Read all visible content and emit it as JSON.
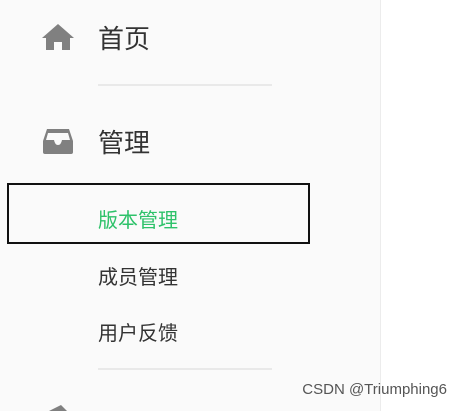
{
  "sidebar": {
    "home": {
      "label": "首页",
      "icon": "home-icon"
    },
    "manage": {
      "label": "管理",
      "icon": "inbox-icon",
      "children": [
        {
          "label": "版本管理",
          "active": true
        },
        {
          "label": "成员管理",
          "active": false
        },
        {
          "label": "用户反馈",
          "active": false
        }
      ]
    }
  },
  "colors": {
    "active_text": "#2ec26a",
    "text": "#333333",
    "icon": "#808080",
    "sidebar_bg": "#fafafa"
  },
  "watermark": "CSDN @Triumphing6"
}
